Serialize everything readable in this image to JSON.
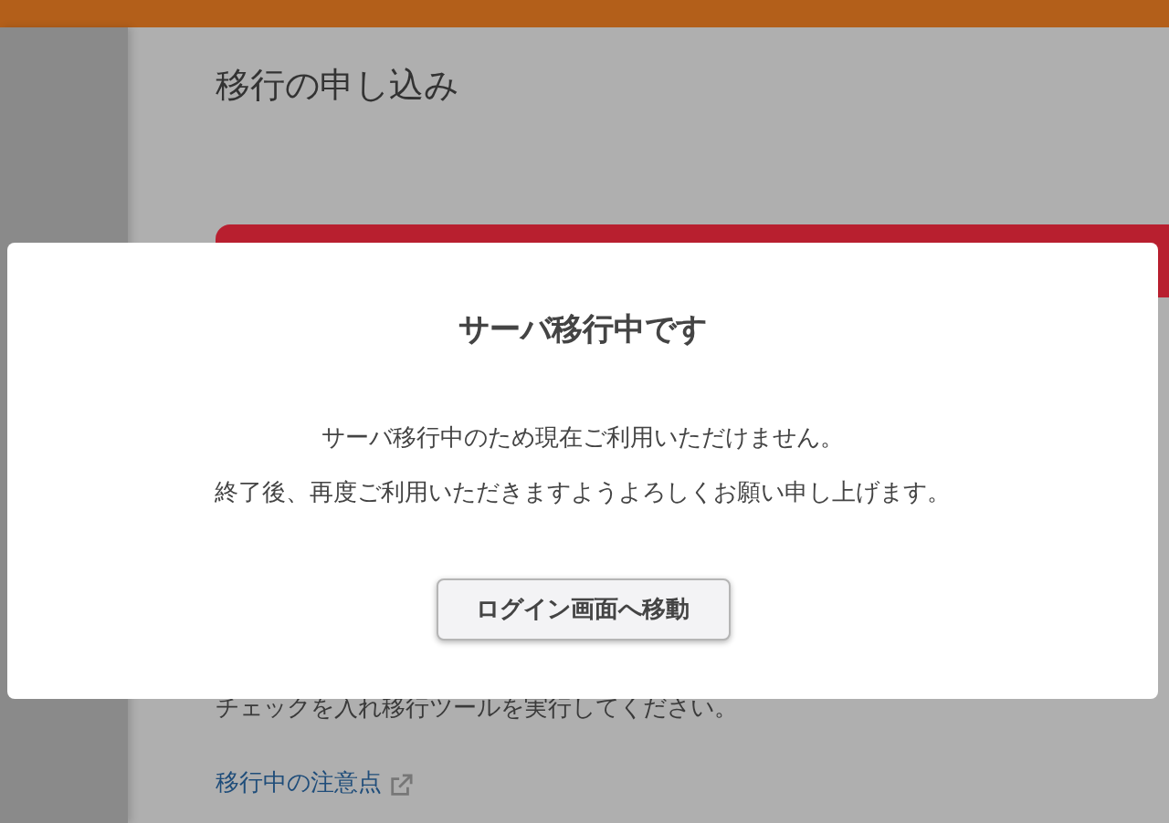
{
  "page": {
    "title": "移行の申し込み",
    "instruction": "チェックを入れ移行ツールを実行してください。",
    "link": "移行中の注意点"
  },
  "dialog": {
    "title": "サーバ移行中です",
    "lines": [
      "サーバ移行中のため現在ご利用いただけません。",
      "終了後、再度ご利用いただきますようよろしくお願い申し上げます。"
    ],
    "button": "ログイン画面へ移動"
  }
}
